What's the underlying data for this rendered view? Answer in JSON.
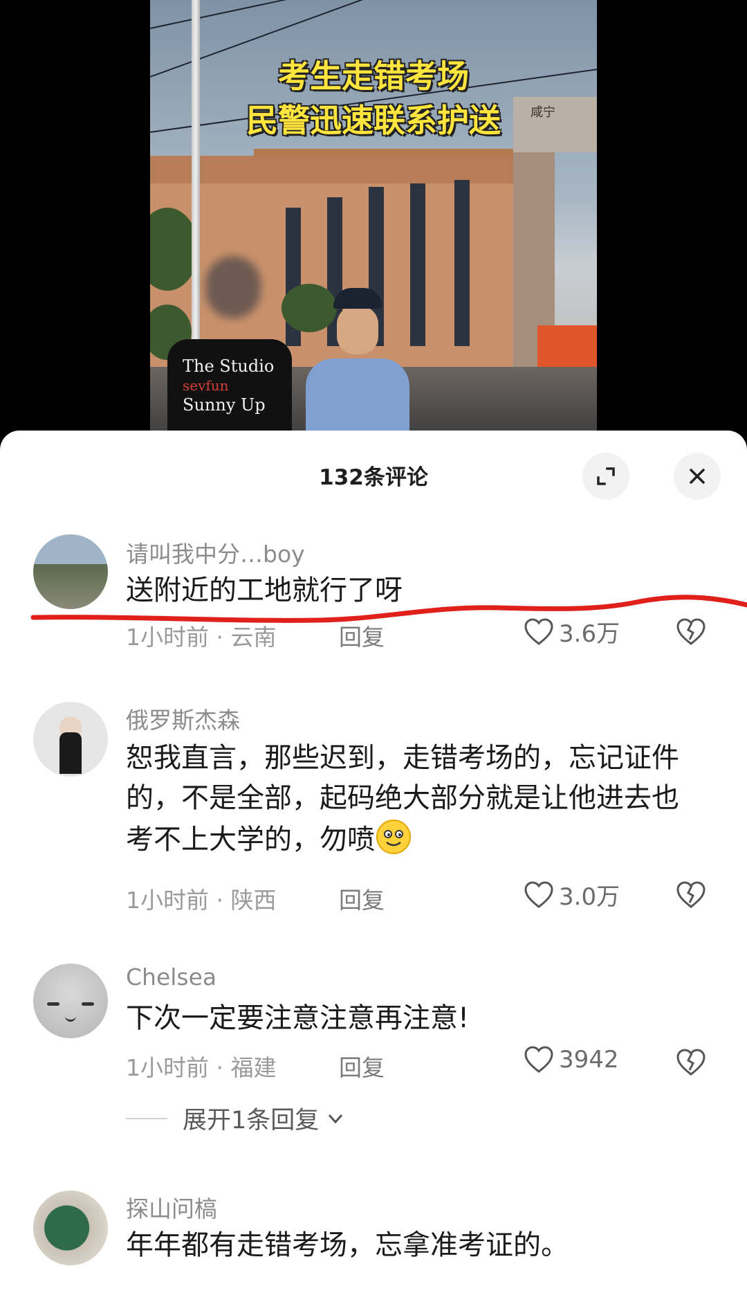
{
  "video": {
    "title_line1": "考生走错考场",
    "title_line2": "民警迅速联系护送",
    "gate_sign": "咸宁",
    "shirt_line1": "The Studio",
    "shirt_line2": "sevfun",
    "shirt_line3": "Sunny Up"
  },
  "sheet": {
    "title": "132条评论",
    "expand_icon": "expand-icon",
    "close_icon": "close-icon"
  },
  "comments": [
    {
      "username": "请叫我中分…boy",
      "text": "送附近的工地就行了呀",
      "time": "1小时前 · 云南",
      "reply_label": "回复",
      "likes": "3.6万"
    },
    {
      "username": "俄罗斯杰森",
      "text": "恕我直言，那些迟到，走错考场的，忘记证件的，不是全部，起码绝大部分就是让他进去也考不上大学的，勿喷",
      "time": "1小时前 · 陕西",
      "reply_label": "回复",
      "likes": "3.0万"
    },
    {
      "username": "Chelsea",
      "text": "下次一定要注意注意再注意!",
      "time": "1小时前 · 福建",
      "reply_label": "回复",
      "likes": "3942",
      "expand_replies": "展开1条回复"
    },
    {
      "username": "探山问槁",
      "text": "年年都有走错考场，忘拿准考证的。"
    }
  ],
  "colors": {
    "title_yellow": "#ffe53d",
    "annotation_red": "#e0201b",
    "text_dark": "#1a1a1a",
    "meta_gray": "#9a9a9a"
  }
}
